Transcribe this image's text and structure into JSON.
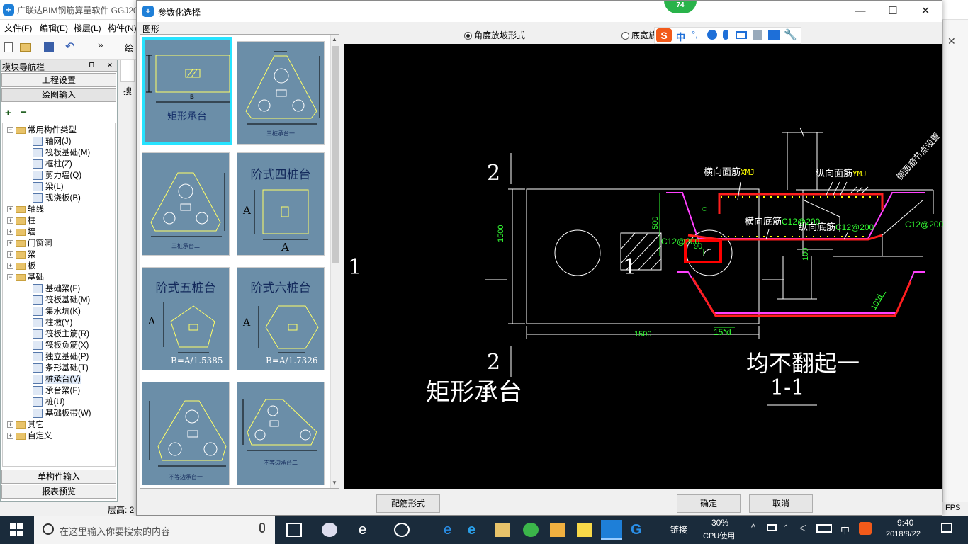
{
  "background_app": {
    "title": "广联达BIM钢筋算量软件 GGJ20",
    "menu": [
      "文件(F)",
      "编辑(E)",
      "楼层(L)",
      "构件(N)"
    ],
    "toolbar_partial_label": "绘",
    "search_partial": "搜",
    "status_left": "层高: 2",
    "status_right": "FPS"
  },
  "nav": {
    "header": "模块导航栏",
    "pin": "⊓",
    "close": "×",
    "btn_project": "工程设置",
    "btn_draw": "绘图输入",
    "btn_single": "单构件输入",
    "btn_report": "报表预览",
    "tree": [
      {
        "label": "常用构件类型",
        "level": 0,
        "type": "folder",
        "expanded": true
      },
      {
        "label": "轴网(J)",
        "level": 1,
        "type": "item"
      },
      {
        "label": "筏板基础(M)",
        "level": 1,
        "type": "item"
      },
      {
        "label": "框柱(Z)",
        "level": 1,
        "type": "item"
      },
      {
        "label": "剪力墙(Q)",
        "level": 1,
        "type": "item"
      },
      {
        "label": "梁(L)",
        "level": 1,
        "type": "item"
      },
      {
        "label": "现浇板(B)",
        "level": 1,
        "type": "item"
      },
      {
        "label": "轴线",
        "level": 0,
        "type": "folder",
        "expanded": false
      },
      {
        "label": "柱",
        "level": 0,
        "type": "folder",
        "expanded": false
      },
      {
        "label": "墙",
        "level": 0,
        "type": "folder",
        "expanded": false
      },
      {
        "label": "门窗洞",
        "level": 0,
        "type": "folder",
        "expanded": false
      },
      {
        "label": "梁",
        "level": 0,
        "type": "folder",
        "expanded": false
      },
      {
        "label": "板",
        "level": 0,
        "type": "folder",
        "expanded": false
      },
      {
        "label": "基础",
        "level": 0,
        "type": "folder",
        "expanded": true
      },
      {
        "label": "基础梁(F)",
        "level": 1,
        "type": "item"
      },
      {
        "label": "筏板基础(M)",
        "level": 1,
        "type": "item"
      },
      {
        "label": "集水坑(K)",
        "level": 1,
        "type": "item"
      },
      {
        "label": "柱墩(Y)",
        "level": 1,
        "type": "item"
      },
      {
        "label": "筏板主筋(R)",
        "level": 1,
        "type": "item"
      },
      {
        "label": "筏板负筋(X)",
        "level": 1,
        "type": "item"
      },
      {
        "label": "独立基础(P)",
        "level": 1,
        "type": "item"
      },
      {
        "label": "条形基础(T)",
        "level": 1,
        "type": "item"
      },
      {
        "label": "桩承台(V)",
        "level": 1,
        "type": "item",
        "selected": true
      },
      {
        "label": "承台梁(F)",
        "level": 1,
        "type": "item"
      },
      {
        "label": "桩(U)",
        "level": 1,
        "type": "item"
      },
      {
        "label": "基础板带(W)",
        "level": 1,
        "type": "item"
      },
      {
        "label": "其它",
        "level": 0,
        "type": "folder",
        "expanded": false
      },
      {
        "label": "自定义",
        "level": 0,
        "type": "folder",
        "expanded": false
      }
    ]
  },
  "dialog": {
    "title": "参数化选择",
    "badge": "74",
    "shapes_label": "图形",
    "radio_angle": "角度放坡形式",
    "radio_width": "底宽放",
    "btn_rebar_form": "配筋形式",
    "btn_ok": "确定",
    "btn_cancel": "取消",
    "thumbs": {
      "t1_caption": "矩形承台",
      "t1_b": "B",
      "t2_caption": "三桩承台一",
      "t3_caption": "三桩承台二",
      "t4_caption": "阶式四桩台",
      "t4_a1": "A",
      "t4_a2": "A",
      "t5_caption": "阶式五桩台",
      "t5_a": "A",
      "t5_b": "B=A/1.5385",
      "t6_caption": "阶式六桩台",
      "t6_a": "A",
      "t6_b": "B=A/1.7326",
      "t7_caption": "不等边承台一",
      "t8_caption": "不等边承台二"
    },
    "preview": {
      "plan_dim_v": "1500",
      "plan_dim_h": "1500",
      "section_2_top": "2",
      "section_2_bottom": "2",
      "section_1_left": "1",
      "section_1_right": "1",
      "plan_title": "矩形承台",
      "lbl_top_x": "横向面筋",
      "lbl_top_x_code": "XMJ",
      "lbl_top_y": "纵向面筋",
      "lbl_top_y_code": "YMJ",
      "lbl_bot_x": "横向底筋",
      "lbl_bot_x_val": "C12@200",
      "lbl_bot_y": "纵向底筋",
      "lbl_bot_y_val": "C12@200",
      "lbl_side": "侧面筋",
      "lbl_side_sub": "节点设置",
      "lbl_right_val": "C12@200",
      "lbl_left_val": "C12@200",
      "dim_500": "500",
      "dim_0": "0",
      "dim_100": "100",
      "dim_90": "90",
      "dim_10d": "10*d",
      "dim_15d": "15*d",
      "note": "均不翻起一",
      "section_title": "1-1"
    }
  },
  "taskbar": {
    "search_placeholder": "在这里输入你要搜索的内容",
    "link_label": "链接",
    "cpu_value": "30%",
    "cpu_label": "CPU使用",
    "lang": "中",
    "time": "9:40",
    "date": "2018/8/22"
  },
  "colors": {
    "preview_bg": "#000000",
    "rebar_red": "#ff1e1e",
    "magenta": "#ff40ff",
    "dim_green": "#33ff33",
    "thumb_bg": "#6b8ea8",
    "thumb_selected": "#27e3ff",
    "highlight": "#ff0000"
  }
}
